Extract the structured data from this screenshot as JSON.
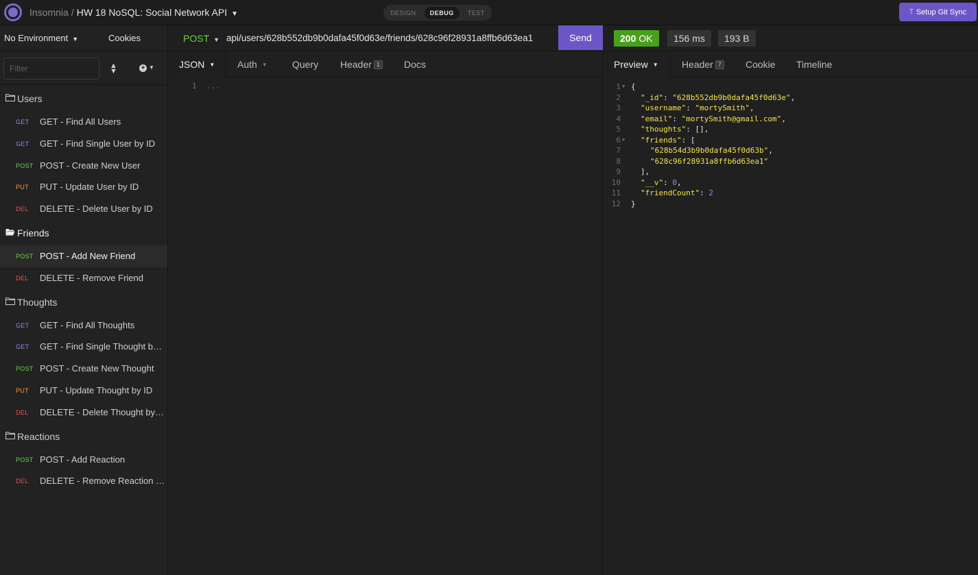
{
  "app": {
    "name": "Insomnia",
    "separator": "/",
    "project": "HW 18 NoSQL: Social Network API",
    "modes": [
      "DESIGN",
      "DEBUG",
      "TEST"
    ],
    "active_mode": "DEBUG",
    "git_sync_label": "Setup Git Sync",
    "accent_color": "#6c56c7"
  },
  "sidebar": {
    "environment": "No Environment",
    "cookies": "Cookies",
    "filter_placeholder": "Filter",
    "folders": [
      {
        "name": "Users",
        "open": false,
        "requests": [
          {
            "method": "GET",
            "name": "GET - Find All Users"
          },
          {
            "method": "GET",
            "name": "GET - Find Single User by ID"
          },
          {
            "method": "POST",
            "name": "POST - Create New User"
          },
          {
            "method": "PUT",
            "name": "PUT - Update User by ID"
          },
          {
            "method": "DEL",
            "name": "DELETE - Delete User by ID"
          }
        ]
      },
      {
        "name": "Friends",
        "open": true,
        "requests": [
          {
            "method": "POST",
            "name": "POST - Add New Friend",
            "active": true
          },
          {
            "method": "DEL",
            "name": "DELETE - Remove Friend"
          }
        ]
      },
      {
        "name": "Thoughts",
        "open": false,
        "requests": [
          {
            "method": "GET",
            "name": "GET - Find All Thoughts"
          },
          {
            "method": "GET",
            "name": "GET - Find Single Thought by ID"
          },
          {
            "method": "POST",
            "name": "POST - Create New Thought"
          },
          {
            "method": "PUT",
            "name": "PUT - Update Thought by ID"
          },
          {
            "method": "DEL",
            "name": "DELETE - Delete Thought by ID"
          }
        ]
      },
      {
        "name": "Reactions",
        "open": false,
        "requests": [
          {
            "method": "POST",
            "name": "POST - Add Reaction"
          },
          {
            "method": "DEL",
            "name": "DELETE - Remove Reaction by ID"
          }
        ]
      }
    ]
  },
  "request": {
    "method": "POST",
    "url": "api/users/628b552db9b0dafa45f0d63e/friends/628c96f28931a8ffb6d63ea1",
    "send_label": "Send",
    "tabs": [
      {
        "label": "JSON",
        "dropdown": true,
        "active": true
      },
      {
        "label": "Auth",
        "dropdown": true
      },
      {
        "label": "Query"
      },
      {
        "label": "Header",
        "badge": "1"
      },
      {
        "label": "Docs"
      }
    ],
    "body_line_number": "1",
    "body_placeholder": "..."
  },
  "response": {
    "status_code": "200",
    "status_text": "OK",
    "time": "156 ms",
    "size": "193 B",
    "status_color": "#48a11b",
    "tabs": [
      {
        "label": "Preview",
        "dropdown": true,
        "active": true
      },
      {
        "label": "Header",
        "badge": "7"
      },
      {
        "label": "Cookie"
      },
      {
        "label": "Timeline"
      }
    ],
    "lines": [
      {
        "n": "1",
        "fold": true,
        "indent": 0,
        "parts": [
          [
            "k",
            "{"
          ]
        ]
      },
      {
        "n": "2",
        "indent": 1,
        "parts": [
          [
            "s",
            "\"_id\""
          ],
          [
            "k",
            ": "
          ],
          [
            "s",
            "\"628b552db9b0dafa45f0d63e\""
          ],
          [
            "k",
            ","
          ]
        ]
      },
      {
        "n": "3",
        "indent": 1,
        "parts": [
          [
            "s",
            "\"username\""
          ],
          [
            "k",
            ": "
          ],
          [
            "s",
            "\"mortySmith\""
          ],
          [
            "k",
            ","
          ]
        ]
      },
      {
        "n": "4",
        "indent": 1,
        "parts": [
          [
            "s",
            "\"email\""
          ],
          [
            "k",
            ": "
          ],
          [
            "s",
            "\"mortySmith@gmail.com\""
          ],
          [
            "k",
            ","
          ]
        ]
      },
      {
        "n": "5",
        "indent": 1,
        "parts": [
          [
            "s",
            "\"thoughts\""
          ],
          [
            "k",
            ": [],"
          ]
        ]
      },
      {
        "n": "6",
        "fold": true,
        "indent": 1,
        "parts": [
          [
            "s",
            "\"friends\""
          ],
          [
            "k",
            ": ["
          ]
        ]
      },
      {
        "n": "7",
        "indent": 2,
        "parts": [
          [
            "s",
            "\"628b54d3b9b0dafa45f0d63b\""
          ],
          [
            "k",
            ","
          ]
        ]
      },
      {
        "n": "8",
        "indent": 2,
        "parts": [
          [
            "s",
            "\"628c96f28931a8ffb6d63ea1\""
          ]
        ]
      },
      {
        "n": "9",
        "indent": 1,
        "parts": [
          [
            "k",
            "],"
          ]
        ]
      },
      {
        "n": "10",
        "indent": 1,
        "parts": [
          [
            "s",
            "\"__v\""
          ],
          [
            "k",
            ": "
          ],
          [
            "num",
            "0"
          ],
          [
            "k",
            ","
          ]
        ]
      },
      {
        "n": "11",
        "indent": 1,
        "parts": [
          [
            "s",
            "\"friendCount\""
          ],
          [
            "k",
            ": "
          ],
          [
            "num",
            "2"
          ]
        ]
      },
      {
        "n": "12",
        "indent": 0,
        "parts": [
          [
            "k",
            "}"
          ]
        ]
      }
    ]
  }
}
